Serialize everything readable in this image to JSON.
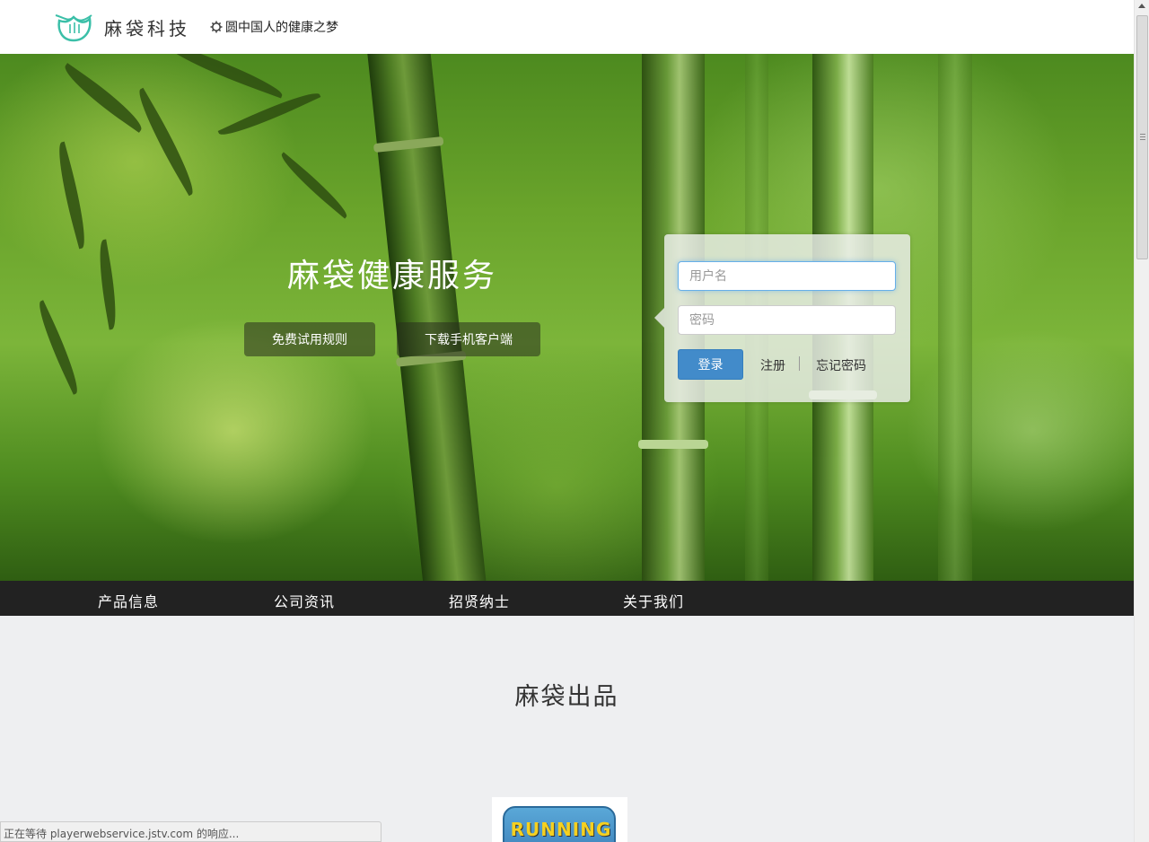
{
  "header": {
    "brand": "麻袋科技",
    "tagline": "圆中国人的健康之梦",
    "logo_icon": "bamboo-leaf-logo-icon",
    "tagline_icon": "gear-icon"
  },
  "hero": {
    "title": "麻袋健康服务",
    "buttons": {
      "rules": "免费试用规则",
      "download": "下载手机客户端"
    }
  },
  "login": {
    "username_placeholder": "用户名",
    "password_placeholder": "密码",
    "submit": "登录",
    "register": "注册",
    "forgot": "忘记密码"
  },
  "nav": {
    "items": [
      "产品信息",
      "公司资讯",
      "招贤纳士",
      "关于我们"
    ]
  },
  "products": {
    "section_title": "麻袋出品",
    "card_label": "RUNNING"
  },
  "statusbar": {
    "text": "正在等待 playerwebservice.jstv.com 的响应..."
  },
  "colors": {
    "accent_blue": "#428bca",
    "nav_bg": "#222222",
    "page_bg": "#eeeff1",
    "logo_teal": "#3bbfa8"
  }
}
